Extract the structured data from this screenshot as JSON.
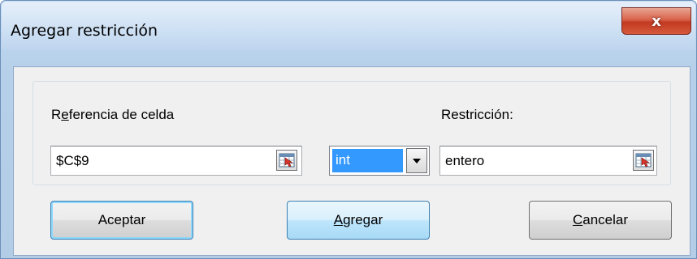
{
  "window": {
    "title": "Agregar restricción",
    "close_glyph": "x"
  },
  "cell_reference": {
    "label_pre": "R",
    "label_accel": "e",
    "label_post": "ferencia de celda",
    "value": "$C$9"
  },
  "operator": {
    "selected": "int"
  },
  "constraint": {
    "label": "Restricción:",
    "value": "entero"
  },
  "buttons": {
    "ok": "Aceptar",
    "add_accel": "A",
    "add_rest": "gregar",
    "cancel_accel": "C",
    "cancel_rest": "ancelar"
  },
  "icons": {
    "collapse": "collapse-dialog-icon",
    "dropdown": "dropdown-arrow-icon",
    "close": "close-icon"
  }
}
